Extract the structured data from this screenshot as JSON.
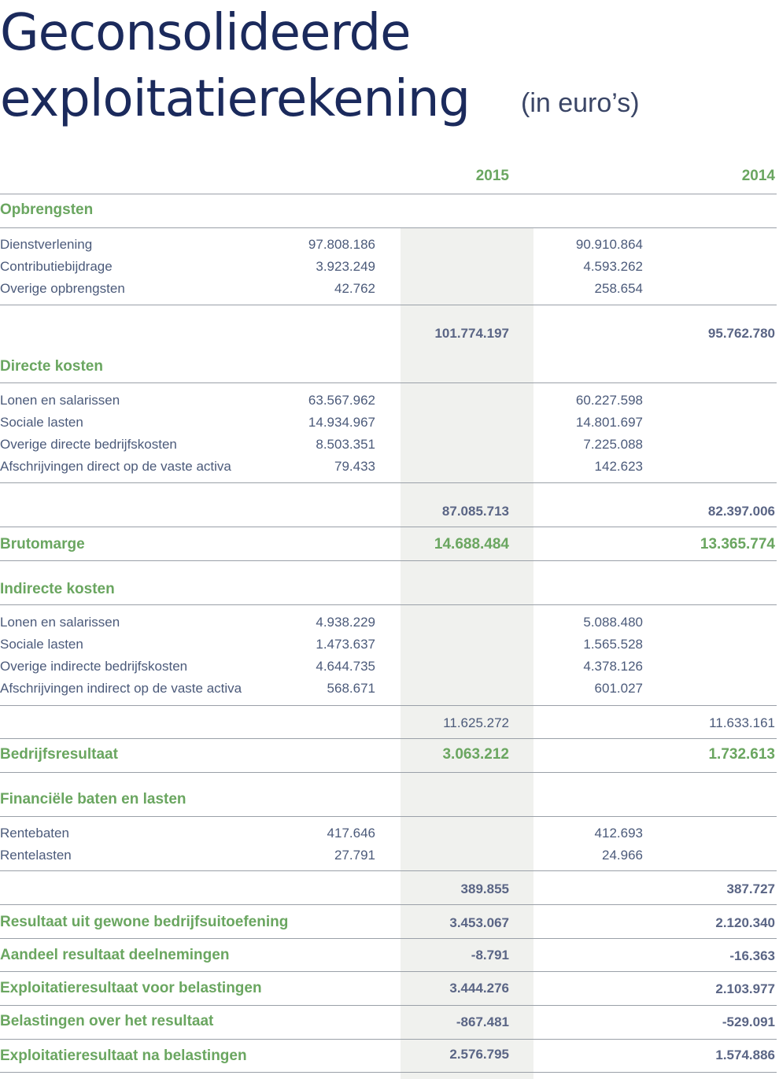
{
  "title_line1": "Geconsolideerde",
  "title_line2": "exploitatierekening",
  "unit": "(in euro’s)",
  "years": [
    "2015",
    "2014"
  ],
  "sections": {
    "opbrengsten": {
      "heading": "Opbrengsten",
      "rows": [
        {
          "label": "Dienstverlening",
          "a": "97.808.186",
          "b": "90.910.864"
        },
        {
          "label": "Contributiebijdrage",
          "a": "3.923.249",
          "b": "4.593.262"
        },
        {
          "label": "Overige opbrengsten",
          "a": "42.762",
          "b": "258.654"
        }
      ],
      "total_a": "101.774.197",
      "total_b": "95.762.780"
    },
    "directe": {
      "heading": "Directe kosten",
      "rows": [
        {
          "label": "Lonen en salarissen",
          "a": "63.567.962",
          "b": "60.227.598"
        },
        {
          "label": "Sociale lasten",
          "a": "14.934.967",
          "b": "14.801.697"
        },
        {
          "label": "Overige directe bedrijfskosten",
          "a": "8.503.351",
          "b": "7.225.088"
        },
        {
          "label": "Afschrijvingen direct op de vaste activa",
          "a": "79.433",
          "b": "142.623"
        }
      ],
      "total_a": "87.085.713",
      "total_b": "82.397.006"
    },
    "brutomarge": {
      "label": "Brutomarge",
      "a": "14.688.484",
      "b": "13.365.774"
    },
    "indirecte": {
      "heading": "Indirecte kosten",
      "rows": [
        {
          "label": "Lonen en salarissen",
          "a": "4.938.229",
          "b": "5.088.480"
        },
        {
          "label": "Sociale lasten",
          "a": "1.473.637",
          "b": "1.565.528"
        },
        {
          "label": "Overige indirecte bedrijfskosten",
          "a": "4.644.735",
          "b": "4.378.126"
        },
        {
          "label": "Afschrijvingen indirect op de vaste activa",
          "a": "568.671",
          "b": "601.027"
        }
      ],
      "total_a": "11.625.272",
      "total_b": "11.633.161"
    },
    "bedrijfsresultaat": {
      "label": "Bedrijfsresultaat",
      "a": "3.063.212",
      "b": "1.732.613"
    },
    "financieel": {
      "heading": "Financiële baten en lasten",
      "rows": [
        {
          "label": "Rentebaten",
          "a": "417.646",
          "b": "412.693"
        },
        {
          "label": "Rentelasten",
          "a": "27.791",
          "b": "24.966"
        }
      ],
      "total_a": "389.855",
      "total_b": "387.727"
    },
    "final_rows": [
      {
        "label": "Resultaat uit gewone bedrijfsuitoefening",
        "a": "3.453.067",
        "b": "2.120.340"
      },
      {
        "label": "Aandeel resultaat deelnemingen",
        "a": "-8.791",
        "b": "-16.363"
      },
      {
        "label": "Exploitatieresultaat voor belastingen",
        "a": "3.444.276",
        "b": "2.103.977"
      },
      {
        "label": "Belastingen over het resultaat",
        "a": "-867.481",
        "b": "-529.091"
      },
      {
        "label": "Exploitatieresultaat na belastingen",
        "a": "2.576.795",
        "b": "1.574.886"
      }
    ]
  },
  "colors": {
    "title": "#1b2a5c",
    "accent_green": "#6aa660",
    "text": "#4b5a7a",
    "shade": "#f0f1ee"
  }
}
